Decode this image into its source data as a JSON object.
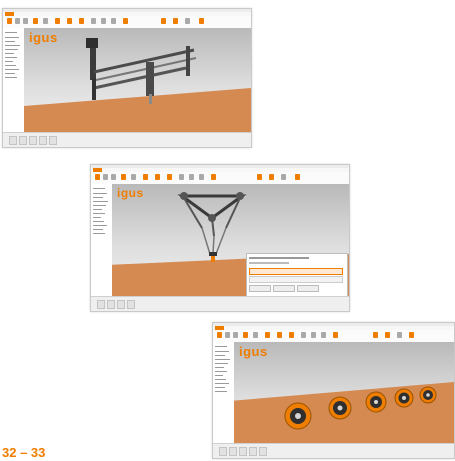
{
  "page_number": "32 – 33",
  "screenshots": [
    {
      "logo": "igus",
      "scene": "linear-gantry-robot"
    },
    {
      "logo": "igus",
      "scene": "delta-robot"
    },
    {
      "logo": "igus",
      "scene": "rotary-joints-row"
    }
  ],
  "colors": {
    "accent": "#ef7d00",
    "floor": "#d58a52",
    "sky": "#c9c9c9"
  }
}
